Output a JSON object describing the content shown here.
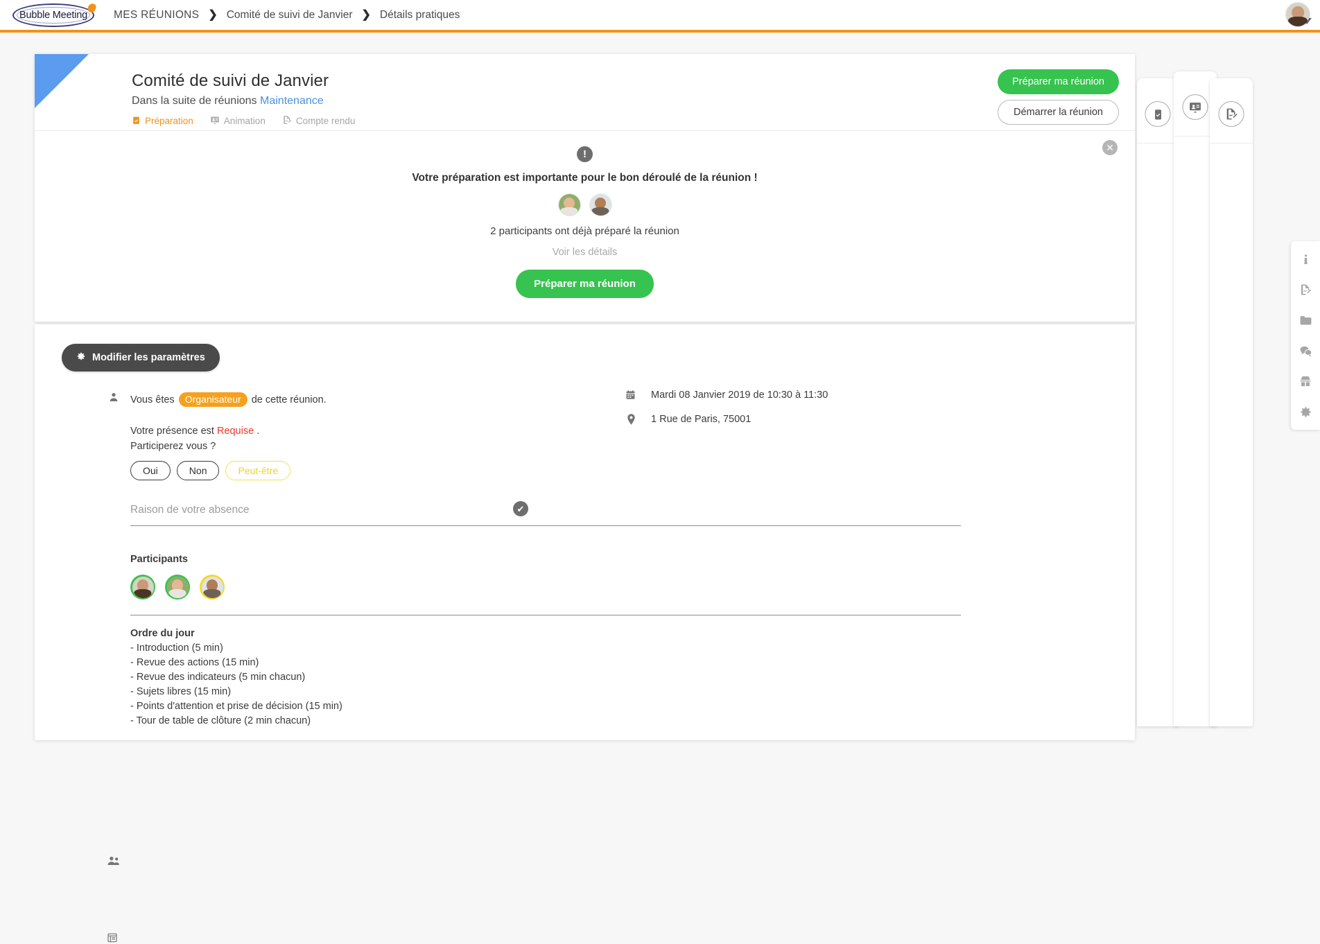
{
  "topbar": {
    "logo_text": "Bubble Meeting",
    "breadcrumb": [
      "MES RÉUNIONS",
      "Comité de suivi de Janvier",
      "Détails pratiques"
    ],
    "separator": "❯",
    "avatar_name": "user-avatar"
  },
  "meeting": {
    "title": "Comité de suivi de Janvier",
    "subtitle_prefix": "Dans la suite de réunions",
    "series_link": "Maintenance",
    "tabs": [
      {
        "label": "Préparation",
        "icon": "clipboard-check-icon",
        "active": true
      },
      {
        "label": "Animation",
        "icon": "presentation-icon",
        "active": false
      },
      {
        "label": "Compte rendu",
        "icon": "report-edit-icon",
        "active": false
      }
    ],
    "primary_button": "Préparer ma réunion",
    "secondary_button": "Démarrer la réunion"
  },
  "banner": {
    "icon": "exclamation-icon",
    "close_icon": "✕",
    "message": "Votre préparation est importante pour le bon déroulé de la réunion !",
    "count_text": "2 participants ont déjà préparé la réunion",
    "details_link": "Voir les détails",
    "cta": "Préparer ma réunion",
    "avatars": [
      "prepared-avatar-1",
      "prepared-avatar-2"
    ]
  },
  "details": {
    "settings_button": "Modifier les paramètres",
    "role_prefix": "Vous êtes",
    "role_badge": "Organisateur",
    "role_suffix": "de cette réunion.",
    "presence_prefix": "Votre présence est",
    "presence_value": "Requise",
    "presence_suffix": ".",
    "question": "Participerez vous ?",
    "choices": [
      {
        "label": "Oui",
        "selected": false
      },
      {
        "label": "Non",
        "selected": false
      },
      {
        "label": "Peut-être",
        "selected": true
      }
    ],
    "absence_placeholder": "Raison de votre absence",
    "confirm_icon": "✔",
    "participants_label": "Participants",
    "participants": [
      {
        "name": "participant-1",
        "ring": "#3fc14f"
      },
      {
        "name": "participant-2",
        "ring": "#3fc14f"
      },
      {
        "name": "participant-3",
        "ring": "#f5d82a"
      }
    ],
    "agenda_title": "Ordre du jour",
    "agenda_items": [
      "- Introduction (5 min)",
      "- Revue des actions (15 min)",
      "- Revue des indicateurs (5 min chacun)",
      "- Sujets libres (15 min)",
      "- Points d'attention et prise de décision (15 min)",
      "- Tour de table de clôture (2 min chacun)"
    ],
    "date_text": "Mardi 08 Janvier 2019 de 10:30 à 11:30",
    "location_text": "1 Rue de Paris, 75001"
  },
  "side_cards": [
    {
      "icon": "clipboard-check-icon"
    },
    {
      "icon": "presentation-icon"
    },
    {
      "icon": "report-edit-icon"
    }
  ],
  "right_rail": [
    {
      "icon": "info-icon"
    },
    {
      "icon": "report-edit-icon"
    },
    {
      "icon": "folder-icon"
    },
    {
      "icon": "chat-icon"
    },
    {
      "icon": "spy-icon"
    },
    {
      "icon": "gear-icon"
    }
  ],
  "colors": {
    "accent_orange": "#f29218",
    "green": "#36c34f",
    "blue_corner": "#5b9bf0",
    "link_blue": "#4a90e2",
    "badge_orange": "#f5a11e",
    "required_red": "#e8382b",
    "maybe_yellow": "#f0d32a"
  }
}
